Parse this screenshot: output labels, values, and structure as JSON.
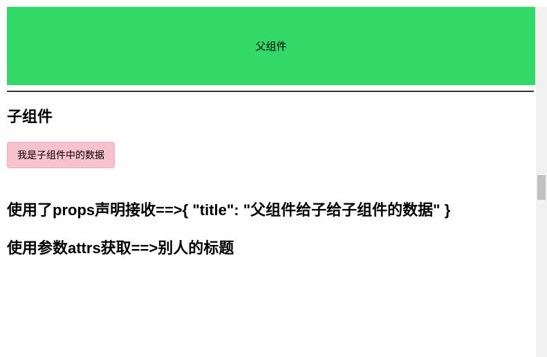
{
  "parent": {
    "label": "父组件"
  },
  "child": {
    "title": "子组件",
    "button_label": "我是子组件中的数据",
    "props_text": "使用了props声明接收==>{ \"title\": \"父组件给子给子组件的数据\" }",
    "attrs_text": "使用参数attrs获取==>别人的标题"
  }
}
